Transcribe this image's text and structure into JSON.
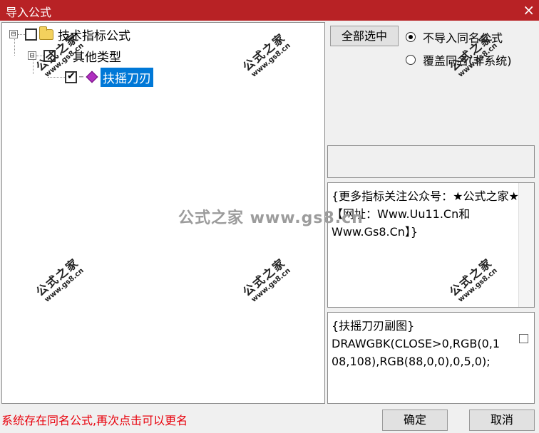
{
  "window": {
    "title": "导入公式",
    "close_icon": "×"
  },
  "tree": {
    "root": {
      "label": "技术指标公式",
      "expander": "⊟",
      "checked": false
    },
    "group": {
      "label": "其他类型",
      "expander": "⊟",
      "checked": false
    },
    "item": {
      "label": "扶摇刀刃",
      "checked": true,
      "dots": "⋯"
    }
  },
  "buttons": {
    "select_all": "全部选中",
    "ok": "确定",
    "cancel": "取消"
  },
  "options": {
    "no_import_same": "不导入同名公式",
    "overwrite_same": "覆盖同名(非系统)",
    "selected": "no_import_same"
  },
  "info_text": "{更多指标关注公众号：★公式之家★ 【网址：Www.Uu11.Cn和Www.Gs8.Cn】}",
  "code_text": "{扶摇刀刃副图}\nDRAWGBK(CLOSE>0,RGB(0,108,108),RGB(88,0,0),0,5,0);",
  "status_message": "系统存在同名公式,再次点击可以更名",
  "watermark": {
    "center": "公式之家 www.gs8.cn",
    "stamp_main": "公式之家",
    "stamp_url": "www.gs8.cn"
  }
}
